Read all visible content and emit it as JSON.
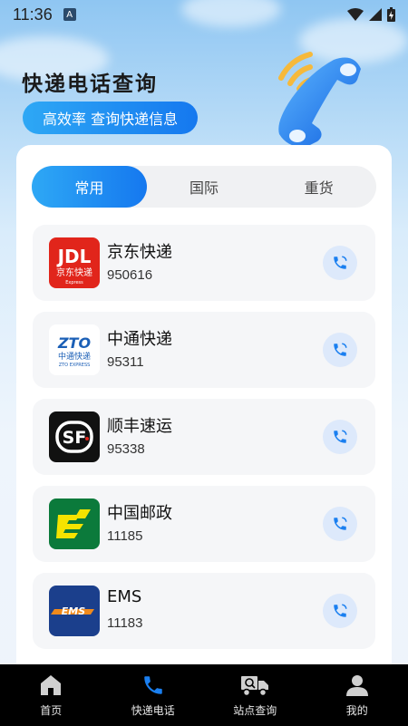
{
  "status_bar": {
    "time": "11:36",
    "notification_letter": "A"
  },
  "header": {
    "title": "快递电话查询",
    "subtitle": "高效率 查询快递信息"
  },
  "tabs": [
    {
      "label": "常用",
      "active": true
    },
    {
      "label": "国际",
      "active": false
    },
    {
      "label": "重货",
      "active": false
    }
  ],
  "couriers": [
    {
      "name": "京东快递",
      "phone": "950616",
      "logo": "jd-logo"
    },
    {
      "name": "中通快递",
      "phone": "95311",
      "logo": "zto-logo"
    },
    {
      "name": "顺丰速运",
      "phone": "95338",
      "logo": "sf-logo"
    },
    {
      "name": "中国邮政",
      "phone": "11185",
      "logo": "china-post-logo"
    },
    {
      "name": "EMS",
      "phone": "11183",
      "logo": "ems-logo"
    }
  ],
  "bottom_nav": [
    {
      "label": "首页",
      "icon": "home-icon",
      "active": false
    },
    {
      "label": "快递电话",
      "icon": "phone-icon",
      "active": true
    },
    {
      "label": "站点查询",
      "icon": "truck-icon",
      "active": false
    },
    {
      "label": "我的",
      "icon": "user-icon",
      "active": false
    }
  ],
  "colors": {
    "accent": "#1a7ff0",
    "accent_light": "#2ea8f5",
    "nav_bg": "#000000"
  }
}
